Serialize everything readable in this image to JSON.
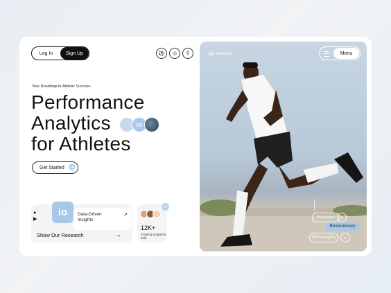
{
  "auth": {
    "login": "Log In",
    "signup": "Sign Up"
  },
  "sport_icons": [
    "soccer-icon",
    "basketball-icon",
    "cycling-icon"
  ],
  "hero": {
    "tagline": "Your Roadmap to Athletic Success.",
    "line1": "Performance",
    "line2": "Analytics",
    "line3": "for Athletes",
    "badge_text": "io",
    "cta": "Get Started"
  },
  "research": {
    "insight": "Data-Driven Insights",
    "label": "Show Our Research",
    "logo": "io"
  },
  "stat": {
    "value": "12K+",
    "caption": "Training programs built"
  },
  "photo": {
    "brand": "AthleteIQ",
    "brand_mark": "io",
    "menu": "Menu",
    "chips": [
      "Innovative",
      "Revolutionary",
      "Encouraging"
    ]
  },
  "colors": {
    "accent": "#a8c8e8",
    "dark": "#111111"
  }
}
